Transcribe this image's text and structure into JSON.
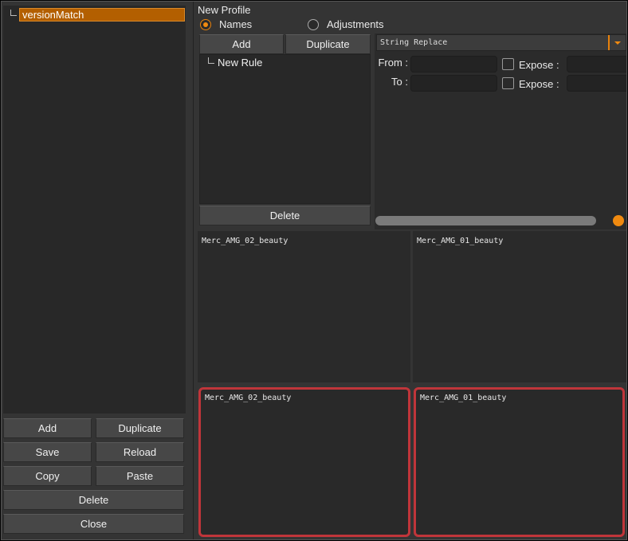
{
  "profiles": {
    "items": [
      {
        "label": "versionMatch",
        "selected": true
      }
    ]
  },
  "left_buttons": {
    "add": "Add",
    "duplicate": "Duplicate",
    "save": "Save",
    "reload": "Reload",
    "copy": "Copy",
    "paste": "Paste",
    "delete": "Delete",
    "close": "Close"
  },
  "editor": {
    "title": "New Profile",
    "mode_names": "Names",
    "mode_adjustments": "Adjustments",
    "selected_mode": "Names"
  },
  "rules": {
    "add": "Add",
    "duplicate": "Duplicate",
    "delete": "Delete",
    "items": [
      {
        "label": "New Rule"
      }
    ]
  },
  "rule_settings": {
    "type": "String Replace",
    "from_label": "From :",
    "to_label": "To :",
    "expose_label": "Expose :",
    "from_value": "",
    "to_value": "",
    "expose_from_value": "",
    "expose_to_value": ""
  },
  "previews": {
    "top_left": "Merc_AMG_02_beauty",
    "top_right": "Merc_AMG_01_beauty",
    "bottom_left": "Merc_AMG_02_beauty",
    "bottom_right": "Merc_AMG_01_beauty"
  },
  "colors": {
    "accent": "#f08a10",
    "selection": "#b35f00",
    "highlight_border": "#c0353a"
  }
}
